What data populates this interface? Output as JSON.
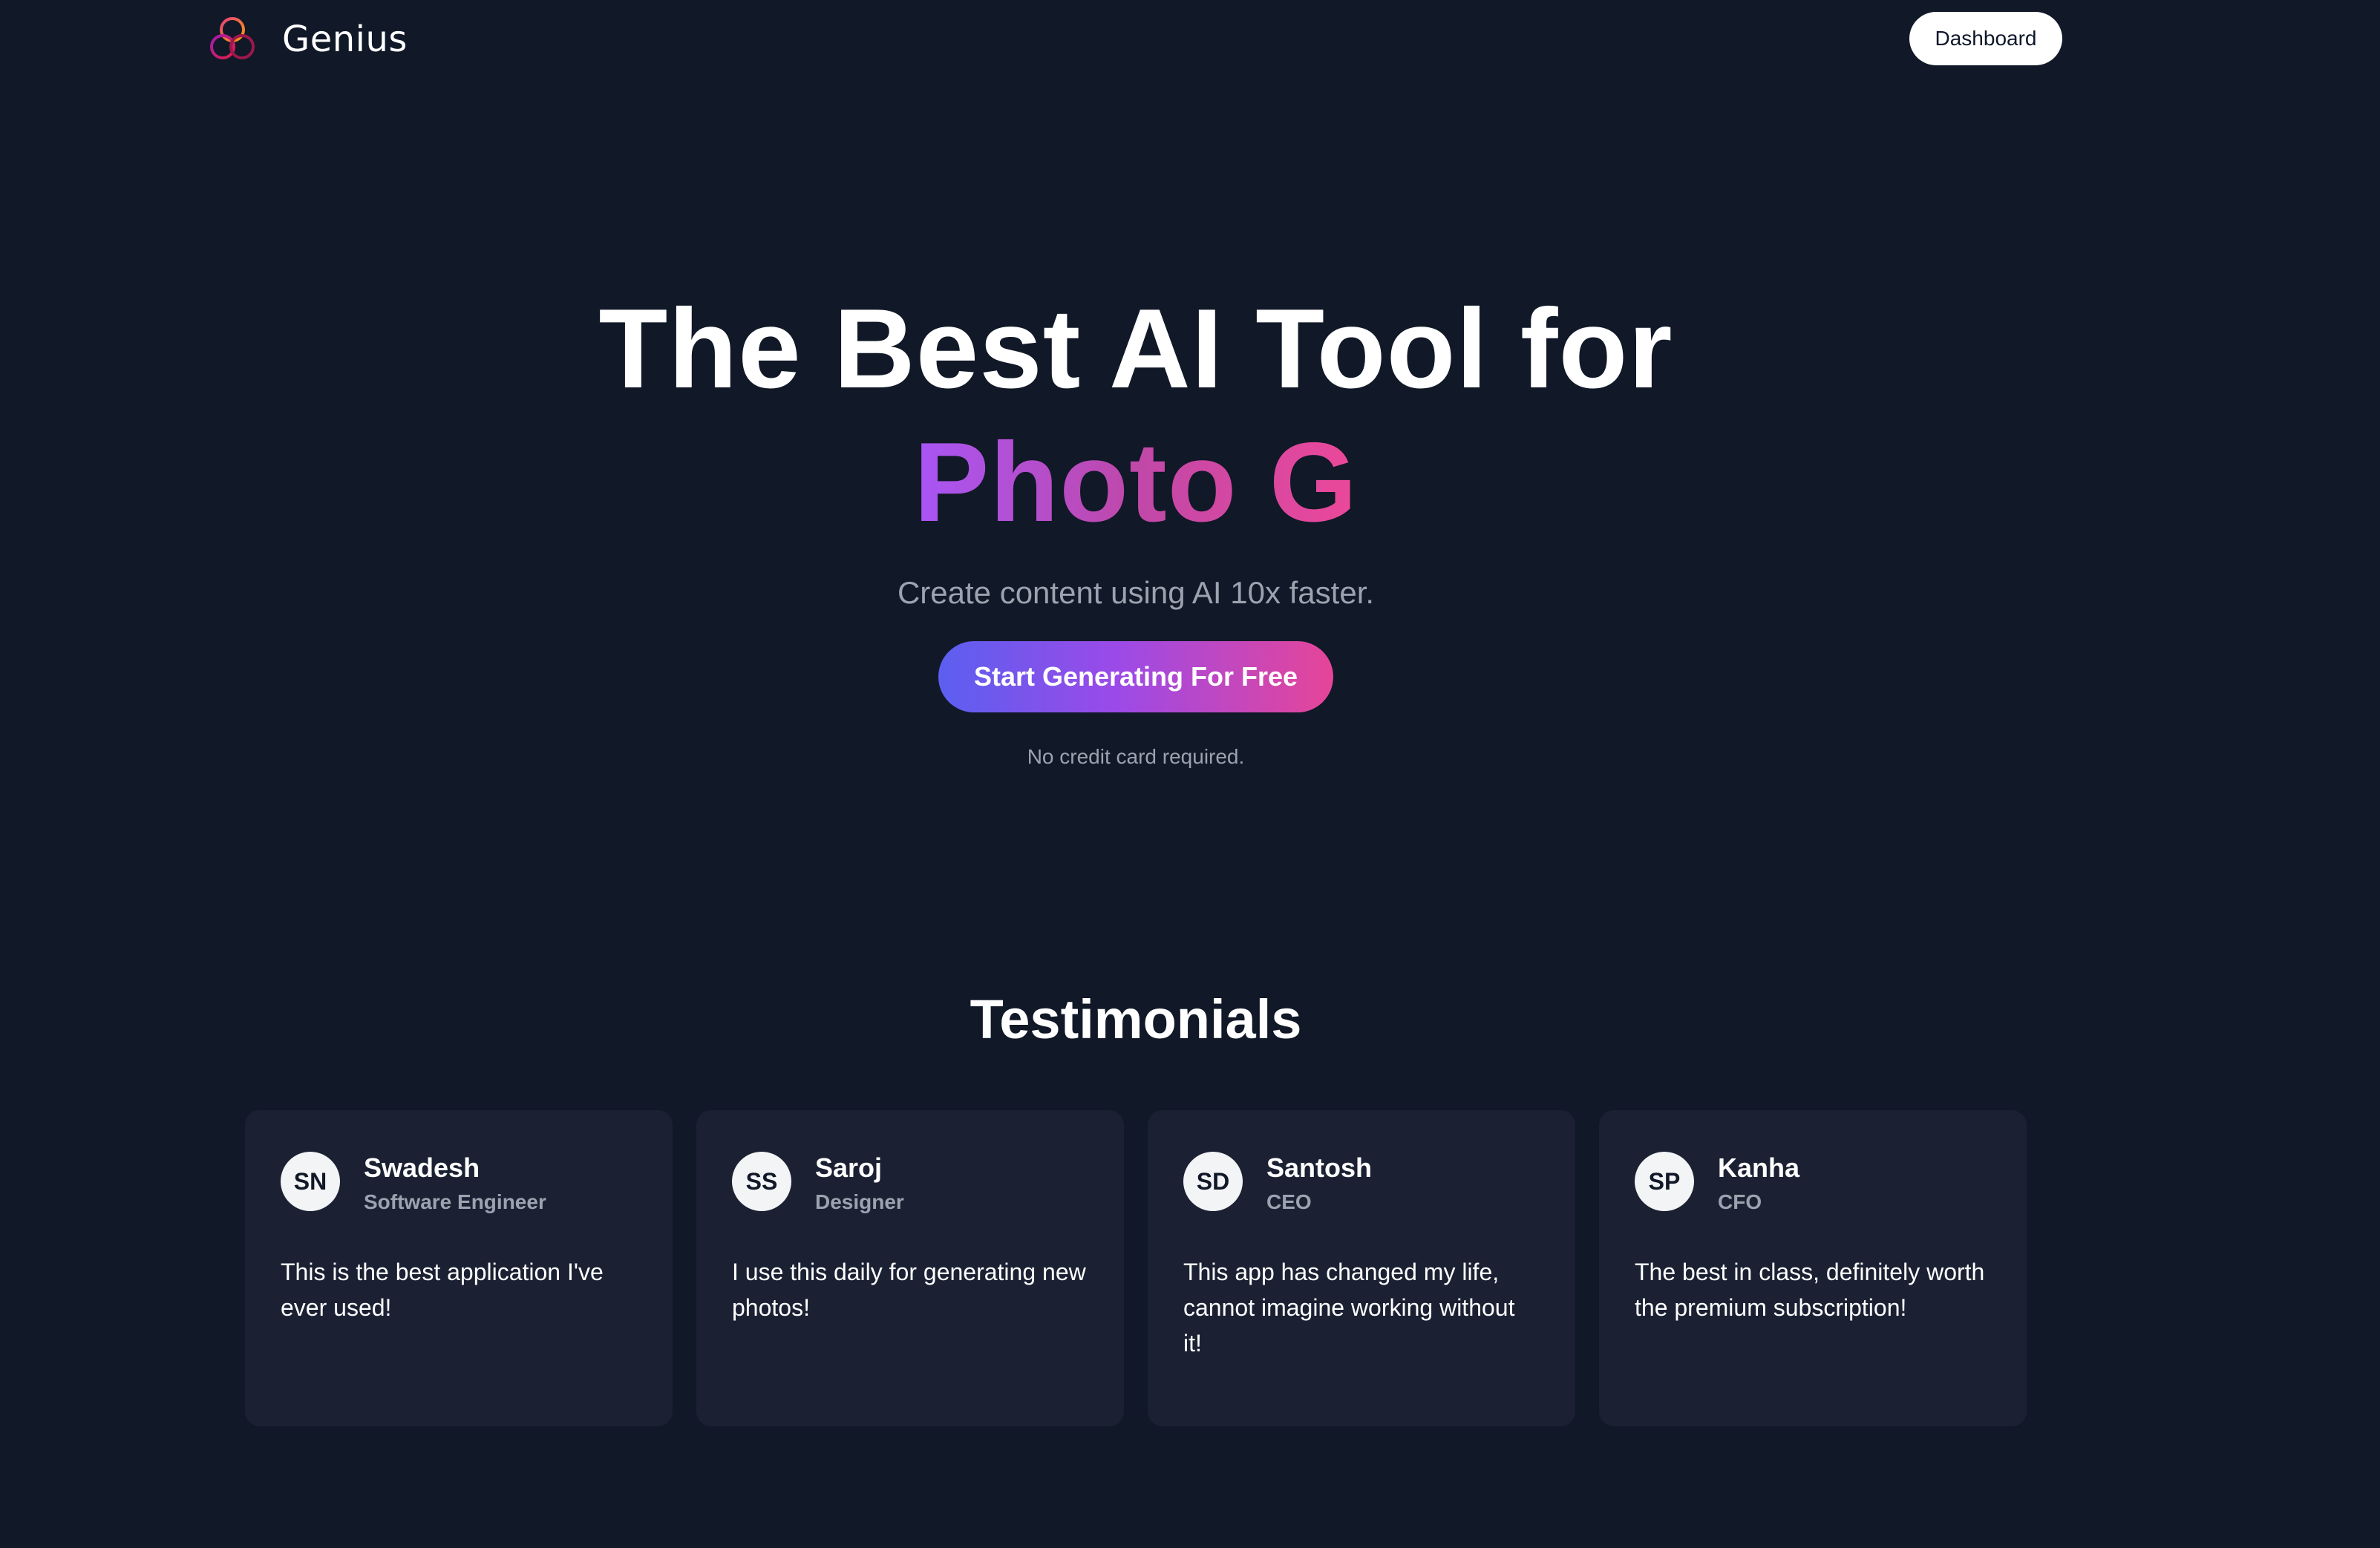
{
  "navbar": {
    "brand": "Genius",
    "logo_icon": "interlocking-rings-logo",
    "dashboard_label": "Dashboard"
  },
  "hero": {
    "title": "The Best AI Tool for",
    "typed_text": "Photo G",
    "subtitle": "Create content using AI 10x faster.",
    "cta_label": "Start Generating For Free",
    "note": "No credit card required."
  },
  "testimonials": {
    "title": "Testimonials",
    "items": [
      {
        "initials": "SN",
        "name": "Swadesh",
        "role": "Software Engineer",
        "quote": "This is the best application I've ever used!"
      },
      {
        "initials": "SS",
        "name": "Saroj",
        "role": "Designer",
        "quote": "I use this daily for generating new photos!"
      },
      {
        "initials": "SD",
        "name": "Santosh",
        "role": "CEO",
        "quote": "This app has changed my life, cannot imagine working without it!"
      },
      {
        "initials": "SP",
        "name": "Kanha",
        "role": "CFO",
        "quote": "The best in class, definitely worth the premium subscription!"
      }
    ]
  },
  "colors": {
    "background": "#111827",
    "card": "#1b2133",
    "muted_text": "#9ca3af",
    "gradient_start": "#5b5ff0",
    "gradient_mid": "#9b4ae8",
    "gradient_end": "#e64598"
  }
}
